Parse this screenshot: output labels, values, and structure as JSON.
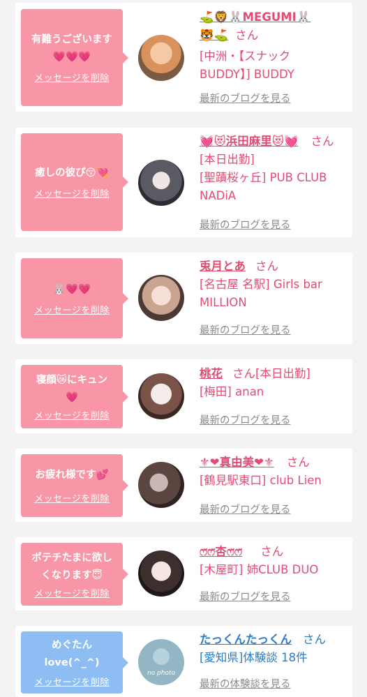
{
  "delete_label": "メッセージを削除",
  "entries": [
    {
      "message": "有難うございます\n💗💗💗",
      "name": "⛳🦁🐰MEGUMI🐰\n🐯⛳",
      "san": "さん",
      "shop": "[中洲・【スナック\nBUDDY】] BUDDY",
      "link": "最新のブログを見る"
    },
    {
      "message": "癒しの彼ぴ😚💘",
      "name": "💓😻浜田麻里😻💓",
      "san": "さん",
      "shop": "[本日出勤]\n[聖蹟桜ヶ丘] PUB CLUB\nNADiA",
      "link": "最新のブログを見る"
    },
    {
      "message": "🐰💗💗",
      "name": "兎月とあ",
      "san": "さん",
      "shop": "[名古屋 名駅] Girls bar\nMILLION",
      "link": "最新のブログを見る"
    },
    {
      "message": "寝顔😿にキュン\n💗",
      "name": "桃花",
      "san": "さん[本日出勤]",
      "shop": "[梅田] anan",
      "link": "最新のブログを見る"
    },
    {
      "message": "お疲れ様です💕",
      "name": "⚜❤真由美❤⚜",
      "san": "さん",
      "shop": "[鶴見駅東口] club Lien",
      "link": "最新のブログを見る"
    },
    {
      "message": "ポテチたまに欲し\nくなります😇",
      "name": "ෆ̈ෆ̈杏ෆ̈ෆ̈",
      "san": "さん",
      "shop": "[木屋町] 姉CLUB DUO",
      "link": "最新のブログを見る"
    },
    {
      "message": "めぐたん\nlove(^_^)",
      "name": "たっくんたっくん",
      "san": "さん",
      "shop": "[愛知県]体験談 18件",
      "link": "最新の体験談を見る",
      "avatar_text": "no photo"
    }
  ],
  "colors": {
    "pink_bubble": "#f895a6",
    "blue_bubble": "#8ebdf3",
    "pink_text": "#e24c72",
    "blue_text": "#2c7cc6",
    "link_gray": "#8a8a8a"
  }
}
